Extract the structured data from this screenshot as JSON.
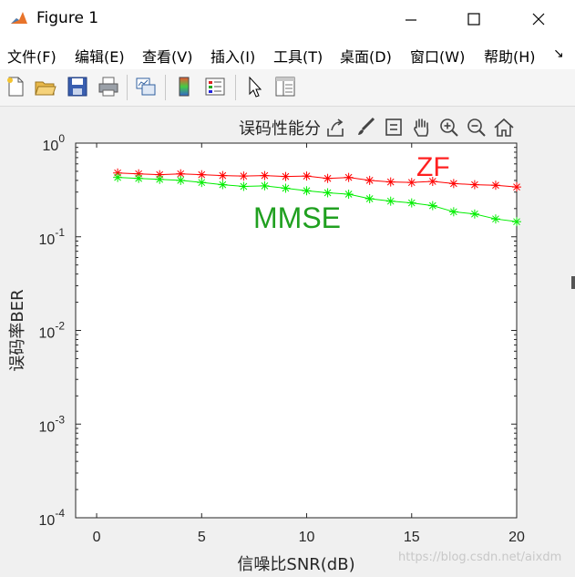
{
  "window": {
    "title": "Figure 1"
  },
  "menu": [
    "文件(F)",
    "编辑(E)",
    "查看(V)",
    "插入(I)",
    "工具(T)",
    "桌面(D)",
    "窗口(W)",
    "帮助(H)"
  ],
  "menu_more": "↘",
  "toolbar_icons": [
    "new-file-icon",
    "open-folder-icon",
    "save-icon",
    "print-icon",
    "link-plot-icon",
    "colorbar-icon",
    "legend-icon",
    "pointer-icon",
    "property-inspector-icon"
  ],
  "axes_toolbar_icons": [
    "export-icon",
    "brush-icon",
    "data-tips-icon",
    "pan-icon",
    "zoom-in-icon",
    "zoom-out-icon",
    "home-icon"
  ],
  "watermark": "https://blog.csdn.net/aixdm",
  "colors": {
    "zf": "#ff0000",
    "mmse": "#00ee00",
    "zf_label": "#ff2020",
    "mmse_label": "#20a020"
  },
  "chart_data": {
    "type": "line",
    "title": "误码性能分",
    "xlabel": "信噪比SNR(dB)",
    "ylabel": "误码率BER",
    "xlim": [
      -1,
      20
    ],
    "ylim": [
      0.0001,
      1
    ],
    "yscale": "log",
    "xticks": [
      "0",
      "5",
      "10",
      "15",
      "20"
    ],
    "ytick_base": "10",
    "ytick_exps": [
      "0",
      "-1",
      "-2",
      "-3",
      "-4"
    ],
    "grid": false,
    "x": [
      1,
      2,
      3,
      4,
      5,
      6,
      7,
      8,
      9,
      10,
      11,
      12,
      13,
      14,
      15,
      16,
      17,
      18,
      19,
      20
    ],
    "series": [
      {
        "name": "ZF",
        "marker": "*",
        "values": [
          0.48,
          0.47,
          0.46,
          0.47,
          0.46,
          0.45,
          0.445,
          0.45,
          0.44,
          0.445,
          0.42,
          0.43,
          0.4,
          0.385,
          0.38,
          0.39,
          0.37,
          0.36,
          0.355,
          0.34
        ]
      },
      {
        "name": "MMSE",
        "marker": "*",
        "values": [
          0.43,
          0.42,
          0.41,
          0.4,
          0.38,
          0.36,
          0.345,
          0.35,
          0.33,
          0.31,
          0.295,
          0.285,
          0.255,
          0.24,
          0.23,
          0.215,
          0.185,
          0.175,
          0.155,
          0.145
        ]
      }
    ]
  }
}
